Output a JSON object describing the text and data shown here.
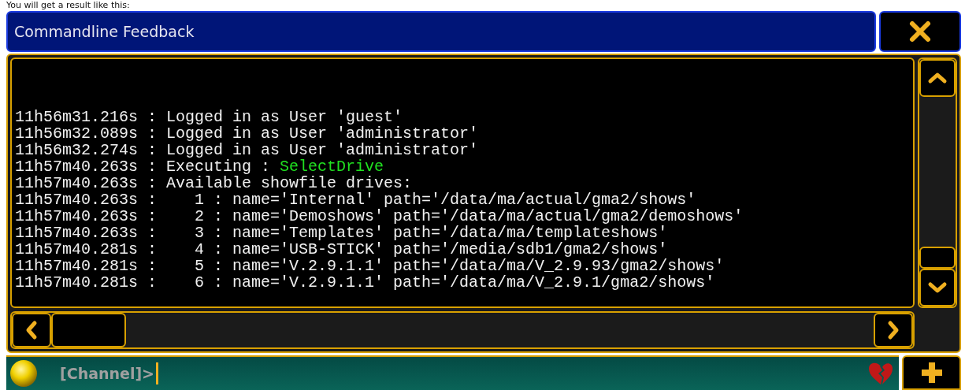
{
  "caption": "You will get a result like this:",
  "window": {
    "title": "Commandline Feedback"
  },
  "log": [
    [
      {
        "kind": "plain",
        "text": "11h56m31.216s : Logged in as User 'guest'"
      }
    ],
    [
      {
        "kind": "plain",
        "text": "11h56m32.089s : Logged in as User 'administrator'"
      }
    ],
    [
      {
        "kind": "plain",
        "text": "11h56m32.274s : Logged in as User 'administrator'"
      }
    ],
    [
      {
        "kind": "plain",
        "text": "11h57m40.263s : Executing : "
      },
      {
        "kind": "command",
        "text": "SelectDrive"
      }
    ],
    [
      {
        "kind": "plain",
        "text": "11h57m40.263s : Available showfile drives:"
      }
    ],
    [
      {
        "kind": "plain",
        "text": "11h57m40.263s :    1 : name='Internal' path='/data/ma/actual/gma2/shows'"
      }
    ],
    [
      {
        "kind": "plain",
        "text": "11h57m40.263s :    2 : name='Demoshows' path='/data/ma/actual/gma2/demoshows'"
      }
    ],
    [
      {
        "kind": "plain",
        "text": "11h57m40.263s :    3 : name='Templates' path='/data/ma/templateshows'"
      }
    ],
    [
      {
        "kind": "plain",
        "text": "11h57m40.281s :    4 : name='USB-STICK' path='/media/sdb1/gma2/shows'"
      }
    ],
    [
      {
        "kind": "plain",
        "text": "11h57m40.281s :    5 : name='V.2.9.1.1' path='/data/ma/V_2.9.93/gma2/shows'"
      }
    ],
    [
      {
        "kind": "plain",
        "text": "11h57m40.281s :    6 : name='V.2.9.1.1' path='/data/ma/V_2.9.1/gma2/shows'"
      }
    ]
  ],
  "command_line": {
    "prompt": "[Channel]>"
  }
}
